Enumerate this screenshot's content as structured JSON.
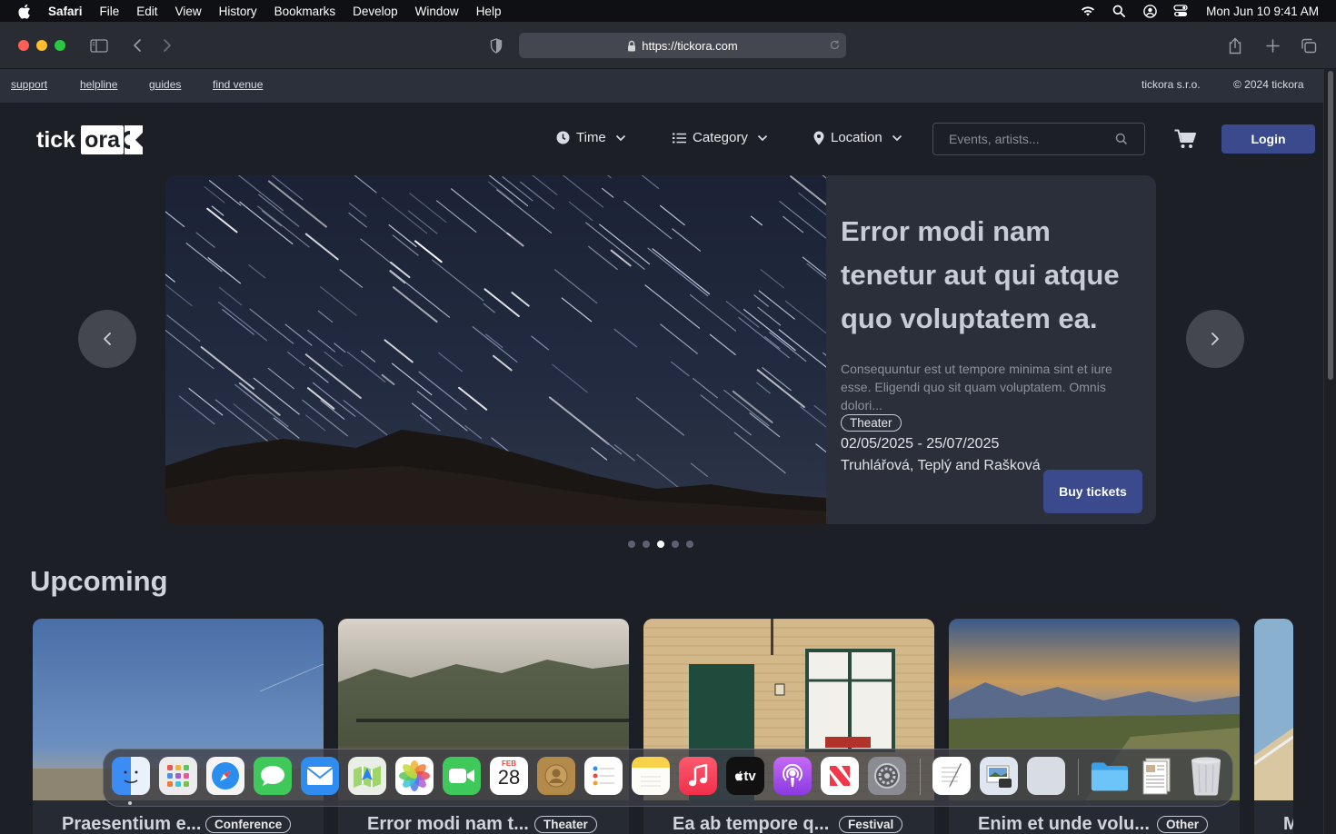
{
  "menubar": {
    "app": "Safari",
    "items": [
      "File",
      "Edit",
      "View",
      "History",
      "Bookmarks",
      "Develop",
      "Window",
      "Help"
    ],
    "clock": "Mon Jun 10  9:41 AM"
  },
  "browser": {
    "url": "https://tickora.com"
  },
  "topstrip": {
    "links": [
      "support",
      "helpline",
      "guides",
      "find venue"
    ],
    "company": "tickora s.r.o.",
    "copyright": "© 2024 tickora"
  },
  "header": {
    "logo_left": "tick",
    "logo_box": "ora",
    "filters": {
      "time": "Time",
      "category": "Category",
      "location": "Location"
    },
    "search_placeholder": "Events, artists...",
    "login": "Login"
  },
  "hero": {
    "title": "Error modi nam tenetur aut qui atque quo voluptatem ea.",
    "description": "Consequuntur est ut tempore minima sint et iure esse. Eligendi quo sit quam voluptatem. Omnis dolori...",
    "tag": "Theater",
    "dates": "02/05/2025 - 25/07/2025",
    "artists": "Truhlářová, Teplý and Rašková",
    "buy": "Buy tickets",
    "active_slide": 3,
    "slide_count": 5
  },
  "upcoming": {
    "heading": "Upcoming",
    "cards": [
      {
        "title": "Praesentium e...",
        "tag": "Conference"
      },
      {
        "title": "Error modi nam t...",
        "tag": "Theater"
      },
      {
        "title": "Ea ab tempore q...",
        "tag": "Festival"
      },
      {
        "title": "Enim et unde volu...",
        "tag": "Other"
      },
      {
        "title": "M",
        "tag": ""
      }
    ]
  },
  "dock": {
    "calendar_month": "FEB",
    "calendar_day": "28",
    "tv_label": "tv",
    "apps": [
      "finder",
      "launchpad",
      "safari",
      "messages",
      "mail",
      "maps",
      "photos",
      "facetime",
      "calendar",
      "contacts",
      "reminders",
      "notes",
      "music",
      "tv",
      "podcasts",
      "news",
      "system-settings",
      "textedit",
      "preview",
      "generic-app",
      "downloads-folder",
      "document-stack",
      "trash"
    ]
  },
  "colors": {
    "accent": "#3a4a8c",
    "page_bg": "#1c1f26",
    "panel_bg": "#2b2f3a"
  }
}
